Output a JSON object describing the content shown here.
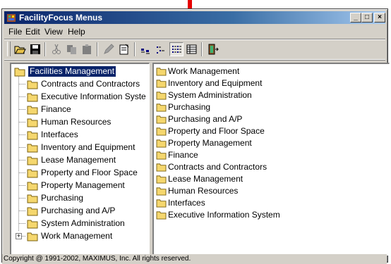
{
  "window": {
    "title": "FacilityFocus Menus",
    "controls": {
      "minimize": "_",
      "maximize": "□",
      "close": "×"
    }
  },
  "menubar": {
    "items": [
      "File",
      "Edit",
      "View",
      "Help"
    ]
  },
  "toolbar": {
    "buttons": [
      "open-folder-icon",
      "save-disk-icon",
      "cut-icon",
      "copy-icon",
      "paste-icon",
      "edit-pencil-icon",
      "properties-icon",
      "large-icons-icon",
      "small-icons-icon",
      "list-view-icon",
      "details-view-icon",
      "exit-door-icon"
    ],
    "pressed": "list-view-icon"
  },
  "tree": {
    "root": "Facilities Management",
    "children": [
      "Contracts and Contractors",
      "Executive Information Syste",
      "Finance",
      "Human Resources",
      "Interfaces",
      "Inventory and Equipment",
      "Lease Management",
      "Property and Floor Space",
      "Property Management",
      "Purchasing",
      "Purchasing and A/P",
      "System Administration",
      "Work Management"
    ]
  },
  "list": {
    "items": [
      "Work Management",
      "Inventory and Equipment",
      "System Administration",
      "Purchasing",
      "Purchasing and A/P",
      "Property and Floor Space",
      "Property Management",
      "Finance",
      "Contracts and Contractors",
      "Lease Management",
      "Human Resources",
      "Interfaces",
      "Executive Information System"
    ]
  },
  "statusbar": {
    "text": "Copyright @ 1991-2002, MAXIMUS, Inc.  All rights reserved."
  },
  "colors": {
    "titlebar": "#0a246a",
    "selection": "#0a246a",
    "folder": "#f5d76e",
    "arrow": "#e60000",
    "chrome": "#d4d0c8"
  }
}
